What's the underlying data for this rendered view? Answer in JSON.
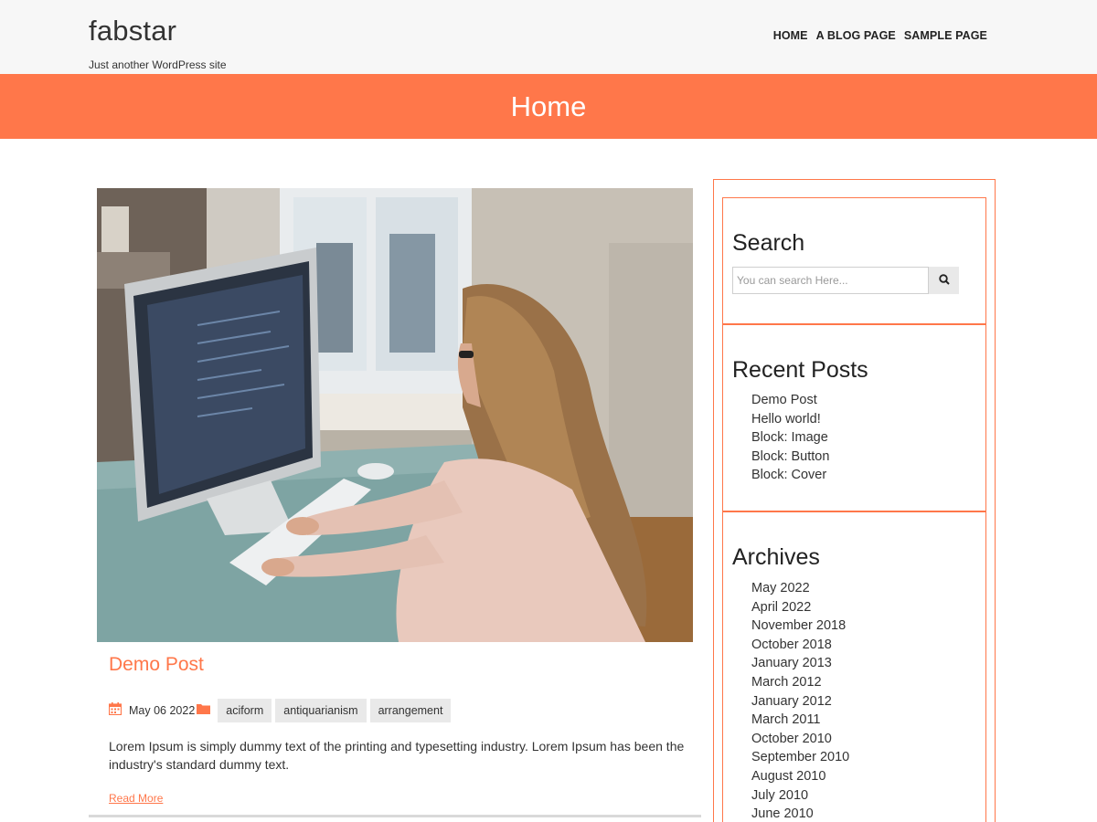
{
  "site": {
    "title": "fabstar",
    "description": "Just another WordPress site"
  },
  "nav": {
    "items": [
      "HOME",
      "A BLOG PAGE",
      "SAMPLE PAGE"
    ]
  },
  "banner": {
    "title": "Home"
  },
  "colors": {
    "accent": "#ff774a",
    "header_bg": "#f7f7f7"
  },
  "post": {
    "title": "Demo Post",
    "date": "May 06 2022",
    "date_icon": "calendar-icon",
    "category_icon": "folder-icon",
    "tags": [
      "aciform",
      "antiquarianism",
      "arrangement"
    ],
    "excerpt": "Lorem Ipsum is simply dummy text of the printing and typesetting industry. Lorem Ipsum has been the industry's standard dummy text.",
    "read_more": "Read More"
  },
  "sidebar": {
    "search": {
      "title": "Search",
      "placeholder": "You can search Here...",
      "button_icon": "search-icon"
    },
    "recent_posts": {
      "title": "Recent Posts",
      "items": [
        "Demo Post",
        "Hello world!",
        "Block: Image",
        "Block: Button",
        "Block: Cover"
      ]
    },
    "archives": {
      "title": "Archives",
      "items": [
        "May 2022",
        "April 2022",
        "November 2018",
        "October 2018",
        "January 2013",
        "March 2012",
        "January 2012",
        "March 2011",
        "October 2010",
        "September 2010",
        "August 2010",
        "July 2010",
        "June 2010"
      ]
    }
  }
}
